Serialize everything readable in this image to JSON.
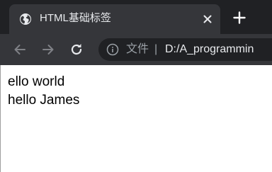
{
  "tab": {
    "title": "HTML基础标签",
    "favicon_icon": "globe-icon",
    "close_icon": "close-icon"
  },
  "new_tab_icon": "plus-icon",
  "toolbar": {
    "back_icon": "arrow-left-icon",
    "forward_icon": "arrow-right-icon",
    "reload_icon": "reload-icon"
  },
  "address_bar": {
    "info_icon": "info-icon",
    "scheme_label": "文件",
    "divider": "|",
    "url": "D:/A_programmin"
  },
  "page": {
    "lines": [
      "ello world",
      "hello James"
    ]
  },
  "colors": {
    "tabstrip_bg": "#202124",
    "toolbar_bg": "#35363a",
    "omnibox_bg": "#202124",
    "text_light": "#e8eaed",
    "text_muted": "#9aa0a6"
  }
}
